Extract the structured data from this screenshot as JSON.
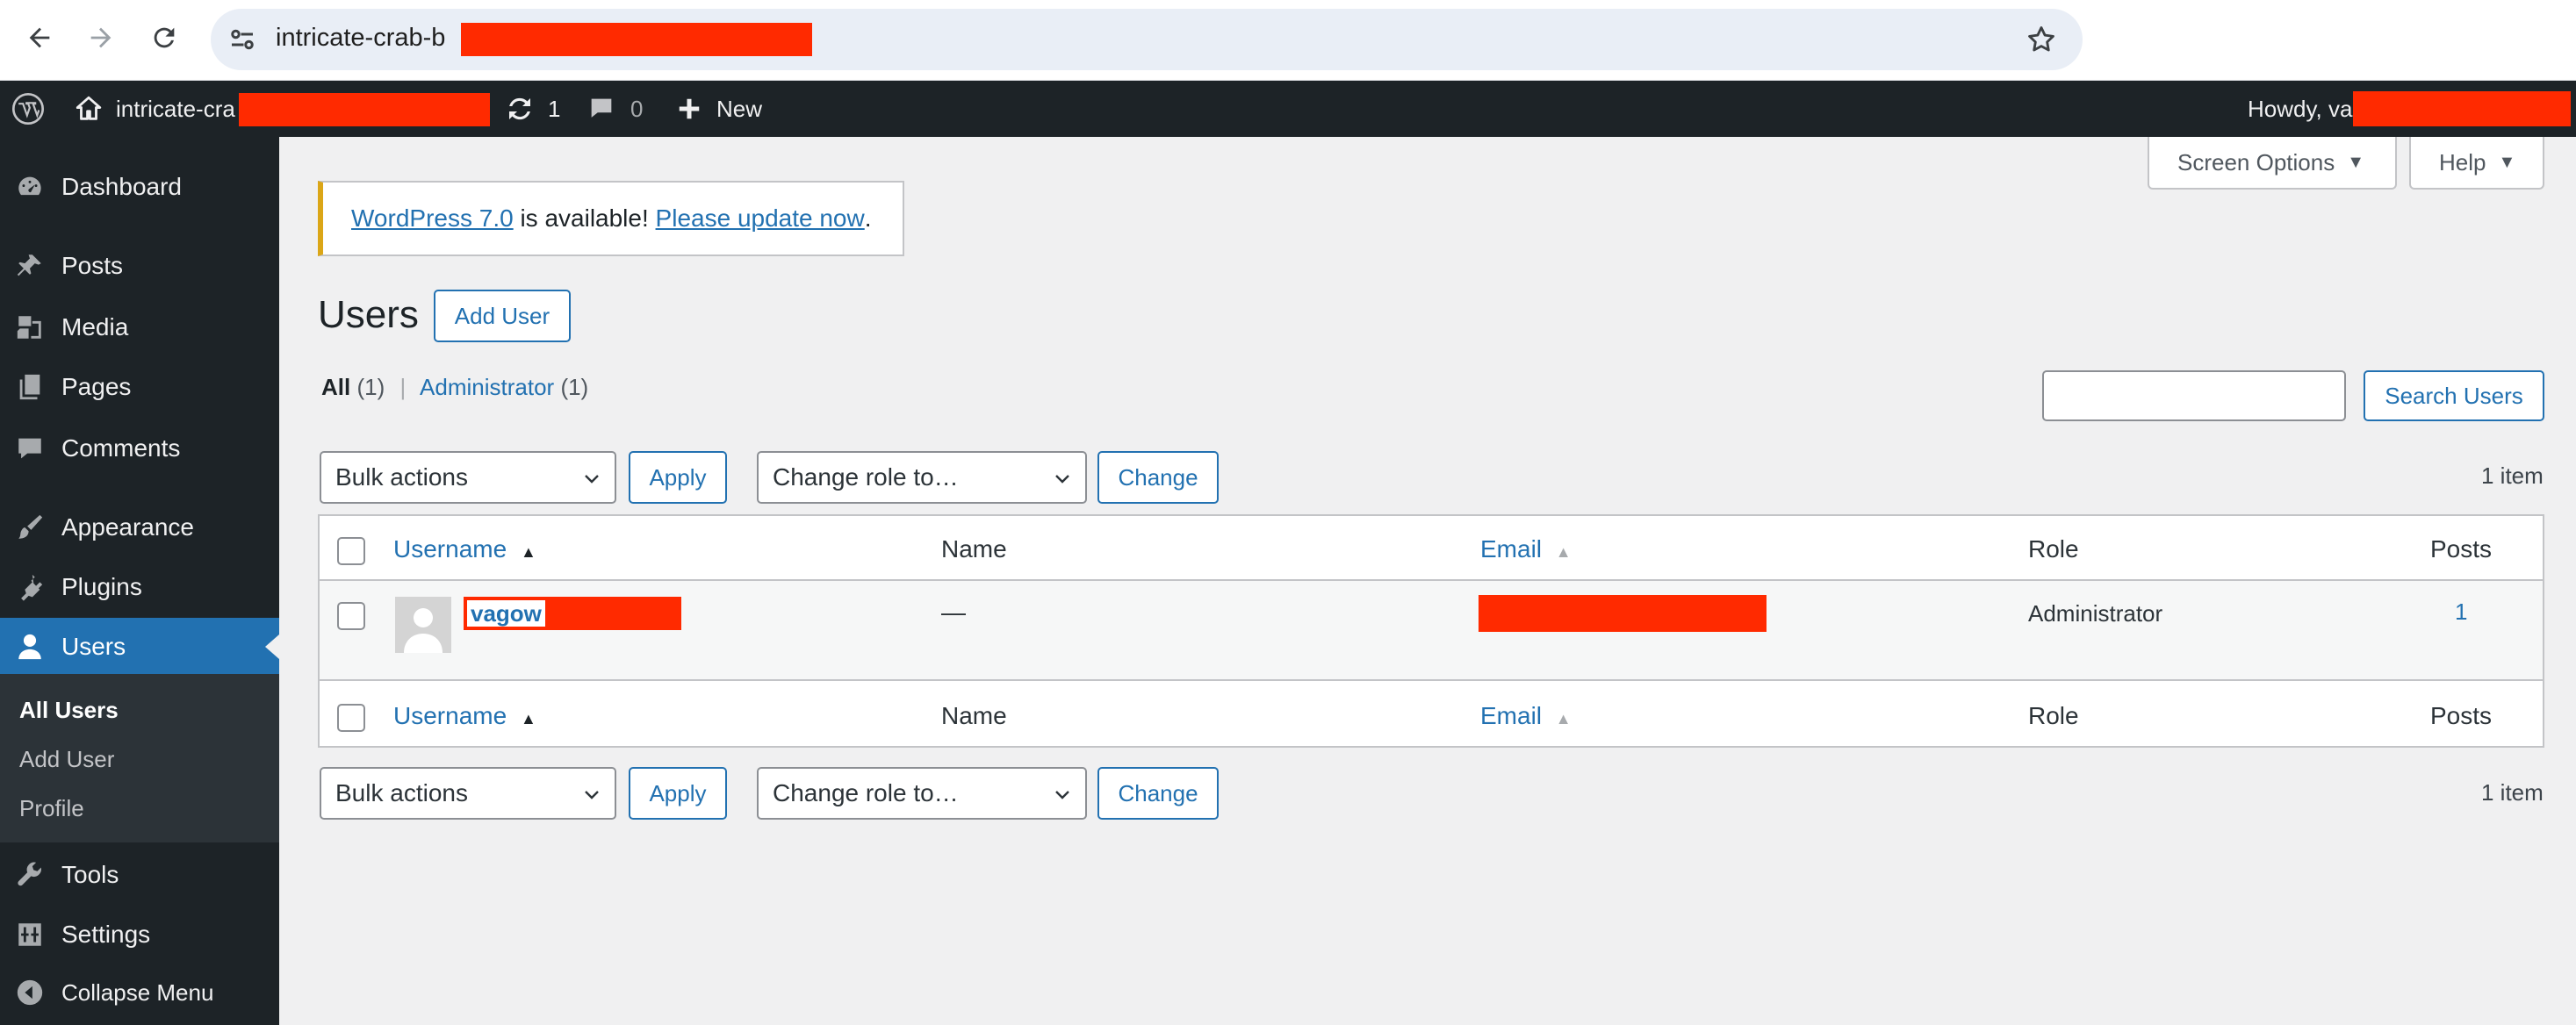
{
  "browser": {
    "url": "intricate-crab-b",
    "back_icon": "arrow-left-icon",
    "forward_icon": "arrow-right-icon",
    "reload_icon": "reload-icon",
    "site_info_icon": "tune-icon",
    "bookmark_icon": "star-icon"
  },
  "adminbar": {
    "site_name": "intricate-cra",
    "updates_count": "1",
    "comments_count": "0",
    "new_label": "New",
    "howdy": "Howdy, va"
  },
  "sidebar": {
    "items": [
      {
        "label": "Dashboard",
        "icon": "dashboard-icon"
      },
      {
        "label": "Posts",
        "icon": "pushpin-icon"
      },
      {
        "label": "Media",
        "icon": "media-icon"
      },
      {
        "label": "Pages",
        "icon": "pages-icon"
      },
      {
        "label": "Comments",
        "icon": "comment-icon"
      },
      {
        "label": "Appearance",
        "icon": "brush-icon"
      },
      {
        "label": "Plugins",
        "icon": "plugin-icon"
      },
      {
        "label": "Users",
        "icon": "user-icon"
      },
      {
        "label": "Tools",
        "icon": "wrench-icon"
      },
      {
        "label": "Settings",
        "icon": "settings-icon"
      },
      {
        "label": "Collapse Menu",
        "icon": "collapse-icon"
      }
    ],
    "submenu": [
      "All Users",
      "Add User",
      "Profile"
    ]
  },
  "screen_options": "Screen Options",
  "help": "Help",
  "notice": {
    "link1": "WordPress 7.0",
    "text": " is available! ",
    "link2": "Please update now",
    "end": "."
  },
  "page": {
    "title": "Users",
    "add_user": "Add User",
    "filter_all": "All",
    "filter_all_count": "(1)",
    "separator": "|",
    "filter_admin": "Administrator",
    "filter_admin_count": "(1)",
    "search_button": "Search Users",
    "search_value": ""
  },
  "tablenav": {
    "bulk_actions": "Bulk actions",
    "apply": "Apply",
    "change_role": "Change role to…",
    "change": "Change",
    "items_count": "1 item"
  },
  "table": {
    "columns": [
      "Username",
      "Name",
      "Email",
      "Role",
      "Posts"
    ],
    "rows": [
      {
        "username": "vagow",
        "name": "—",
        "email": "",
        "role": "Administrator",
        "posts": "1"
      }
    ]
  },
  "colors": {
    "accent": "#2271b1",
    "adminbar": "#1d2327",
    "notice_border": "#dba617",
    "redaction": "#ff2a00"
  }
}
